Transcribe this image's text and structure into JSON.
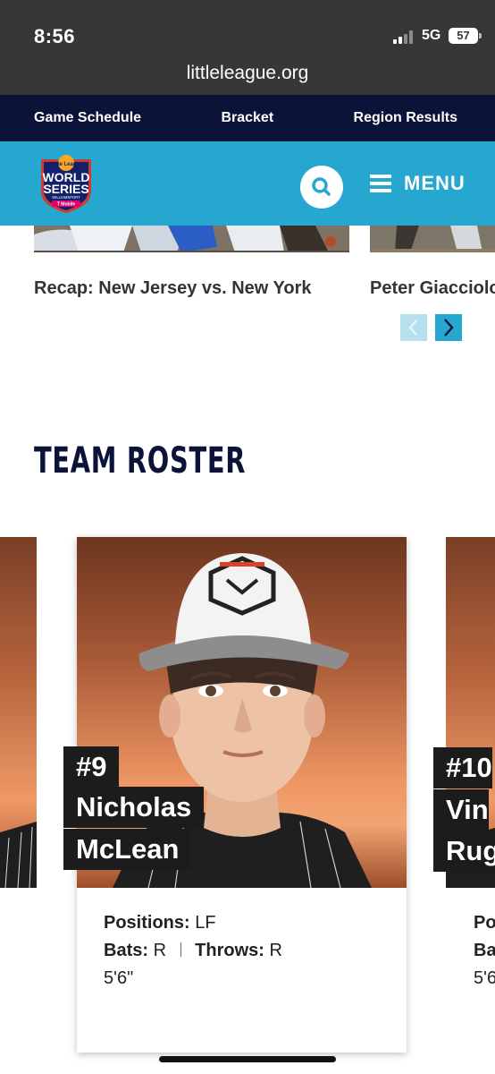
{
  "status_bar": {
    "time": "8:56",
    "network": "5G",
    "battery": "57",
    "url": "littleleague.org"
  },
  "topnav": {
    "items": [
      {
        "label": "Game Schedule"
      },
      {
        "label": "Bracket"
      },
      {
        "label": "Region Results"
      }
    ]
  },
  "header": {
    "logo": {
      "top": "Little League",
      "line1": "WORLD",
      "line2": "SERIES",
      "place": "WILLIAMSPORT",
      "sponsor": "T Mobile"
    },
    "search_icon": "search-icon",
    "menu_label": "MENU"
  },
  "recaps": {
    "cards": [
      {
        "title": "Recap: New Jersey vs. New York"
      },
      {
        "title": "Peter Giacciolo"
      }
    ],
    "prev_icon": "chevron-left-icon",
    "next_icon": "chevron-right-icon"
  },
  "roster": {
    "heading": "TEAM ROSTER",
    "main_player": {
      "number": "#9",
      "first_name": "Nicholas",
      "last_name": "McLean",
      "positions_label": "Positions:",
      "positions": "LF",
      "bats_label": "Bats:",
      "bats": "R",
      "throws_label": "Throws:",
      "throws": "R",
      "height": "5'6\""
    },
    "next_player": {
      "number": "#10",
      "first_name": "Vin",
      "last_name": "Rug",
      "positions_label": "Po",
      "bats_label": "Ba",
      "height": "5'6"
    }
  },
  "colors": {
    "navy": "#0c1338",
    "header_blue": "#25a7d0",
    "status_bar": "#363738"
  }
}
